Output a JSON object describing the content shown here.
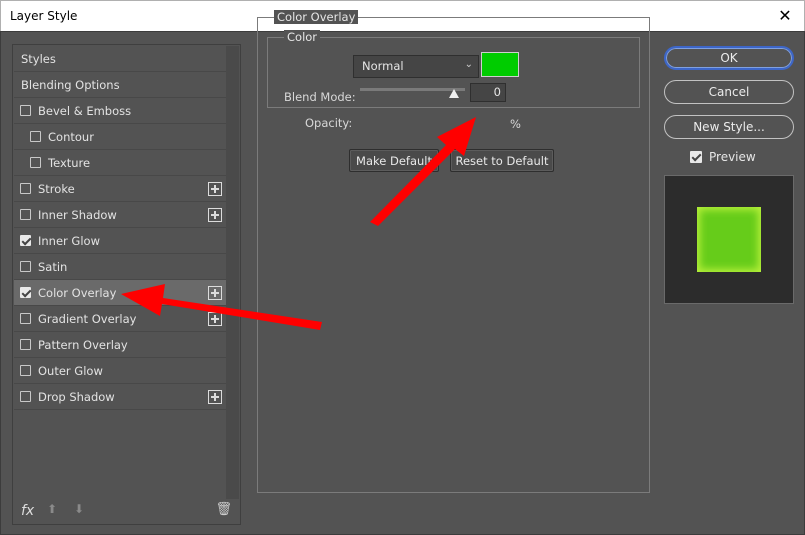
{
  "window": {
    "title": "Layer Style",
    "close_glyph": "✕"
  },
  "left_panel": {
    "items": [
      {
        "label": "Styles",
        "type": "header"
      },
      {
        "label": "Blending Options",
        "type": "header"
      },
      {
        "label": "Bevel & Emboss",
        "checked": false
      },
      {
        "label": "Contour",
        "checked": false,
        "indent": true
      },
      {
        "label": "Texture",
        "checked": false,
        "indent": true
      },
      {
        "label": "Stroke",
        "checked": false,
        "plus": true
      },
      {
        "label": "Inner Shadow",
        "checked": false,
        "plus": true
      },
      {
        "label": "Inner Glow",
        "checked": true
      },
      {
        "label": "Satin",
        "checked": false
      },
      {
        "label": "Color Overlay",
        "checked": true,
        "plus": true,
        "selected": true
      },
      {
        "label": "Gradient Overlay",
        "checked": false,
        "plus": true
      },
      {
        "label": "Pattern Overlay",
        "checked": false
      },
      {
        "label": "Outer Glow",
        "checked": false
      },
      {
        "label": "Drop Shadow",
        "checked": false,
        "plus": true
      }
    ],
    "bottom_icons": {
      "fx": "fx",
      "up": "⬆",
      "down": "⬇",
      "trash": "🗑"
    }
  },
  "center": {
    "outer_legend": "Color Overlay",
    "inner_legend": "Color",
    "blend_mode_label": "Blend Mode:",
    "blend_mode_value": "Normal",
    "chevron": "⌄",
    "swatch_color": "#00cc00",
    "opacity_label": "Opacity:",
    "opacity_value": "0",
    "opacity_unit": "%",
    "make_default_label": "Make Default",
    "reset_default_label": "Reset to Default"
  },
  "right": {
    "ok_label": "OK",
    "cancel_label": "Cancel",
    "new_style_label": "New Style...",
    "preview_label": "Preview",
    "preview_checked": true,
    "preview_color": "#66cc1a"
  },
  "annotations": {
    "arrow_color": "#ff0000"
  }
}
